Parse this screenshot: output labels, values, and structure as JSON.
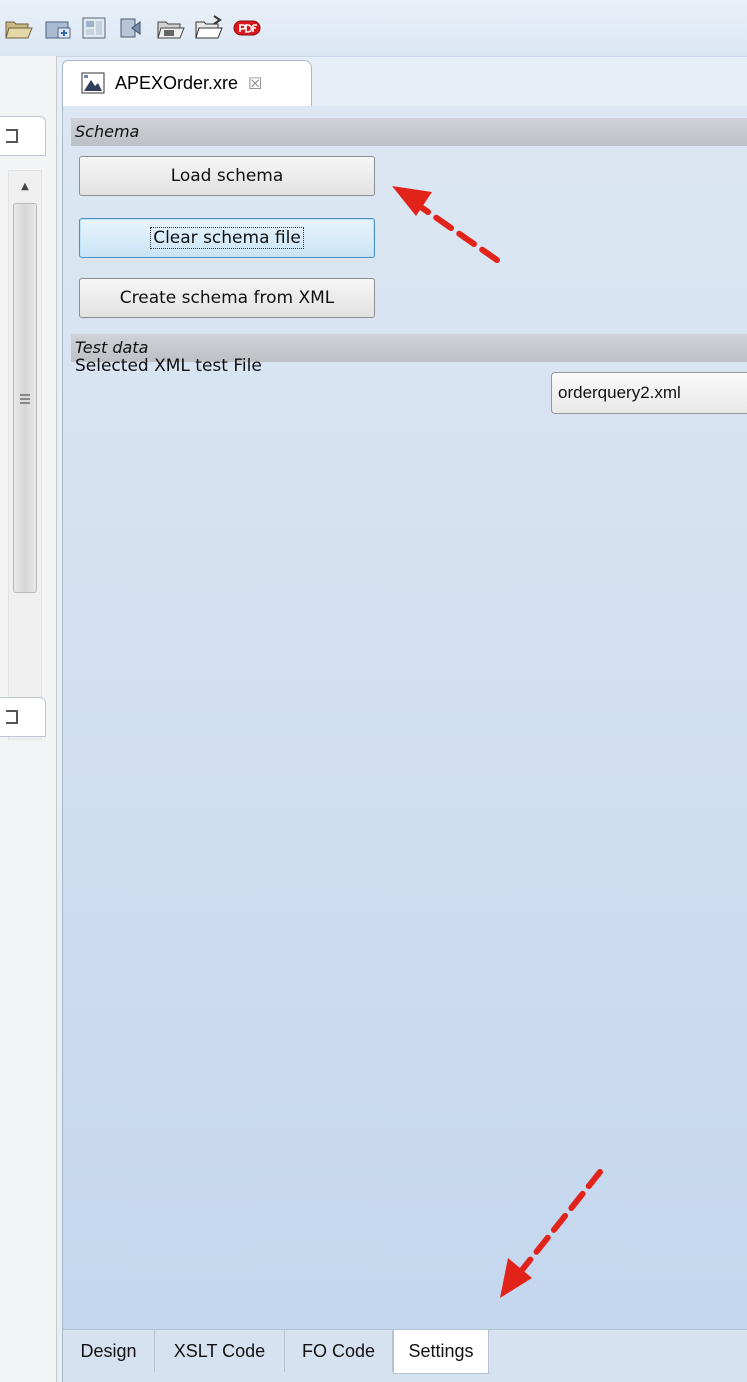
{
  "editor_tab": {
    "title": "APEXOrder.xre",
    "close_glyph": "☒"
  },
  "toolbar": {
    "icons": [
      "open-folder-icon",
      "add-folder-icon",
      "layout-icon",
      "plugin-icon",
      "save-pdf-folder-icon",
      "open-folder-icon",
      "pdf-icon"
    ]
  },
  "sections": {
    "schema": {
      "header": "Schema",
      "load_button": "Load schema",
      "clear_button": "Clear schema file",
      "create_button": "Create schema from XML"
    },
    "test_data": {
      "header": "Test data",
      "selected_label": "Selected XML test File",
      "selected_value": "orderquery2.xml"
    }
  },
  "bottom_tabs": [
    {
      "label": "Design",
      "active": false
    },
    {
      "label": "XSLT Code",
      "active": false
    },
    {
      "label": "FO Code",
      "active": false
    },
    {
      "label": "Settings",
      "active": true
    }
  ],
  "colors": {
    "accent_arrow": "#e2231a",
    "focus_border": "#4a90c4"
  }
}
